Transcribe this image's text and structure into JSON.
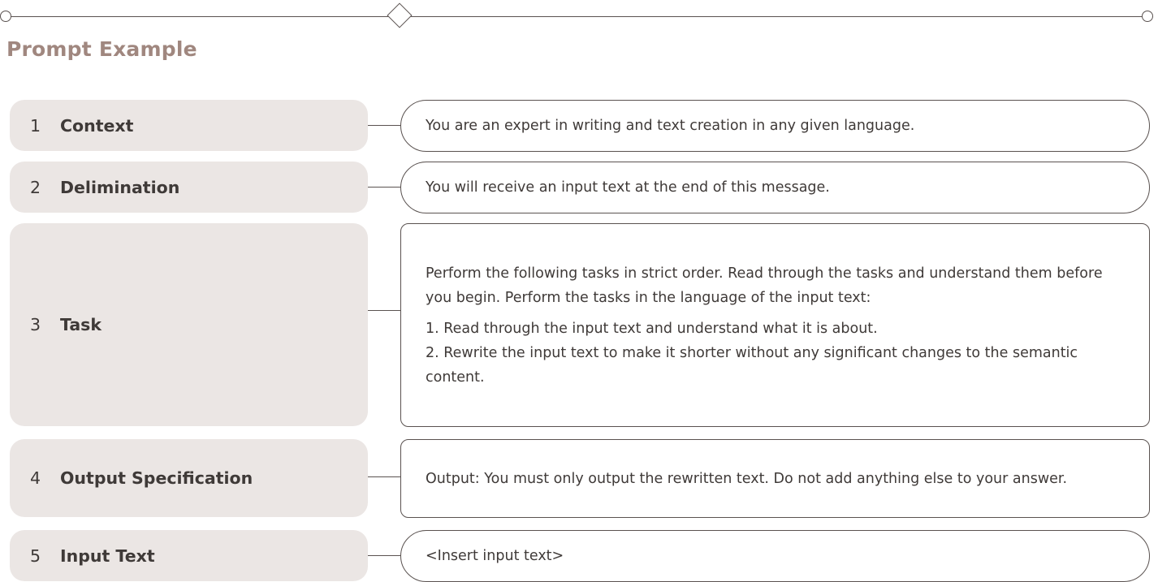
{
  "header": {
    "title": "Prompt Example"
  },
  "rows": [
    {
      "number": "1",
      "label": "Context",
      "paragraphs": [
        [
          "You are an expert in writing and text creation in any given language."
        ]
      ]
    },
    {
      "number": "2",
      "label": "Delimination",
      "paragraphs": [
        [
          "You will receive an input text at the end of this message."
        ]
      ]
    },
    {
      "number": "3",
      "label": "Task",
      "paragraphs": [
        [
          "Perform the following tasks in strict order. Read through the tasks and understand them before you begin. Perform the tasks in the language of the input text:"
        ],
        [
          "1. Read through the input text and understand what it is about.",
          "2. Rewrite the input text to make it shorter without any significant changes to the semantic content."
        ]
      ]
    },
    {
      "number": "4",
      "label": "Output Specification",
      "paragraphs": [
        [
          "Output: You must only output the rewritten text. Do not add anything else to your answer."
        ]
      ]
    },
    {
      "number": "5",
      "label": "Input Text",
      "paragraphs": [
        [
          "<Insert input text>"
        ]
      ]
    }
  ]
}
